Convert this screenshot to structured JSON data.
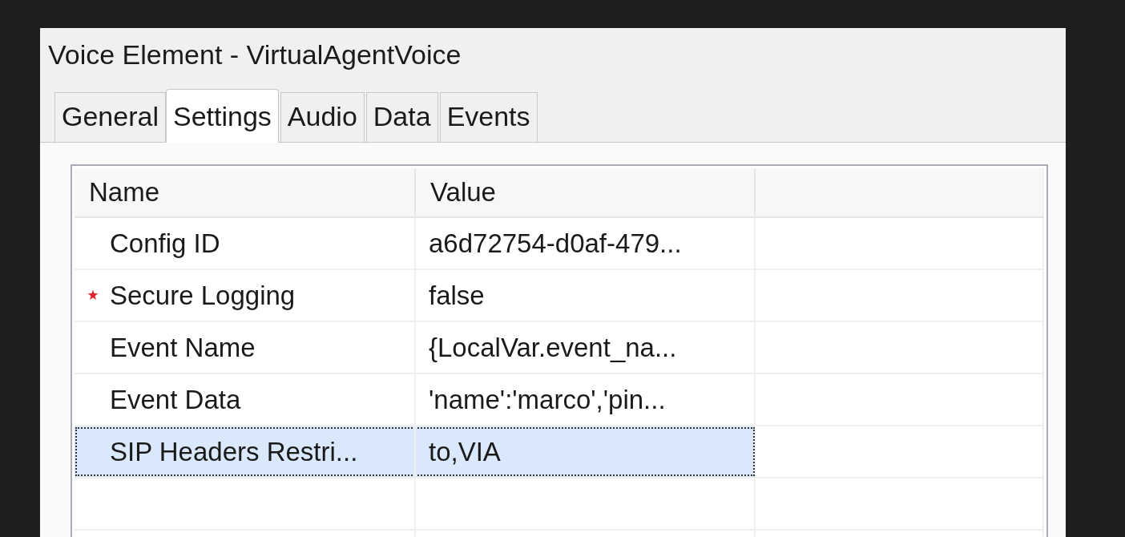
{
  "window": {
    "title": "Voice Element - VirtualAgentVoice"
  },
  "tabs": [
    {
      "label": "General",
      "selected": false
    },
    {
      "label": "Settings",
      "selected": true
    },
    {
      "label": "Audio",
      "selected": false
    },
    {
      "label": "Data",
      "selected": false
    },
    {
      "label": "Events",
      "selected": false
    }
  ],
  "table": {
    "columns": [
      "Name",
      "Value"
    ],
    "rows": [
      {
        "name": "Config ID",
        "value": "a6d72754-d0af-479...",
        "required": false,
        "selected": false
      },
      {
        "name": "Secure Logging",
        "value": "false",
        "required": true,
        "selected": false
      },
      {
        "name": "Event Name",
        "value": "{LocalVar.event_na...",
        "required": false,
        "selected": false
      },
      {
        "name": "Event Data",
        "value": "'name':'marco','pin...",
        "required": false,
        "selected": false
      },
      {
        "name": "SIP Headers Restri...",
        "value": "to,VIA",
        "required": false,
        "selected": true
      }
    ]
  }
}
